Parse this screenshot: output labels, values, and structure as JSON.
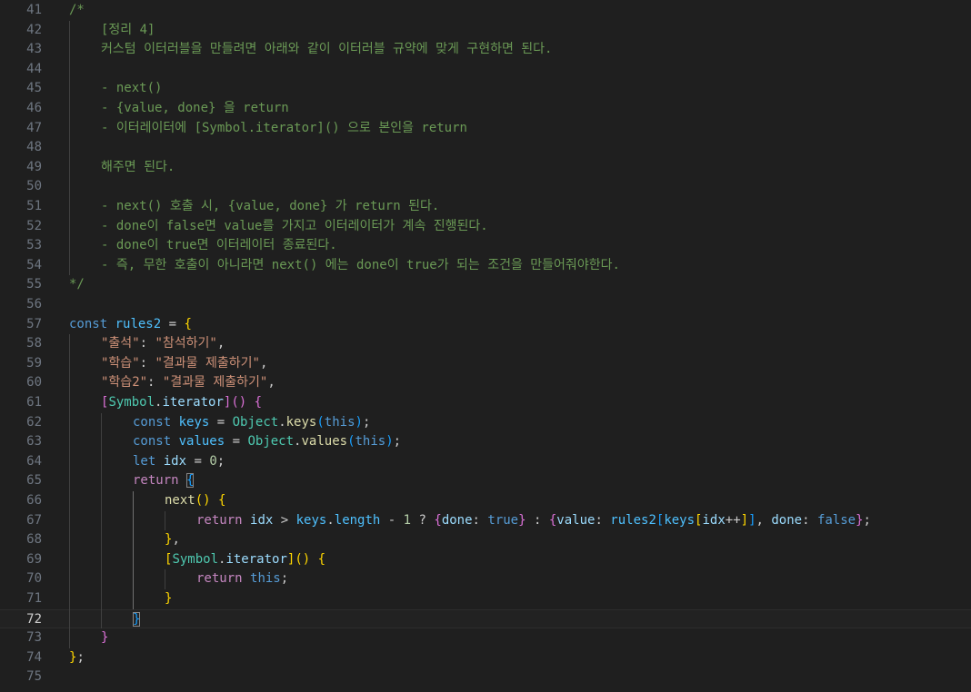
{
  "editor": {
    "language": "javascript",
    "active_line": 72,
    "lines": [
      {
        "n": "41",
        "indent": 0,
        "tokens": [
          {
            "c": "comment",
            "t": "/*"
          }
        ]
      },
      {
        "n": "42",
        "indent": 1,
        "tokens": [
          {
            "c": "comment",
            "t": "[정리 4]"
          }
        ]
      },
      {
        "n": "43",
        "indent": 1,
        "tokens": [
          {
            "c": "comment",
            "t": "커스텀 이터러블을 만들려면 아래와 같이 이터러블 규약에 맞게 구현하면 된다."
          }
        ]
      },
      {
        "n": "44",
        "indent": 0,
        "tokens": []
      },
      {
        "n": "45",
        "indent": 1,
        "tokens": [
          {
            "c": "comment",
            "t": "- next()"
          }
        ]
      },
      {
        "n": "46",
        "indent": 1,
        "tokens": [
          {
            "c": "comment",
            "t": "- {value, done} 을 return"
          }
        ]
      },
      {
        "n": "47",
        "indent": 1,
        "tokens": [
          {
            "c": "comment",
            "t": "- 이터레이터에 [Symbol.iterator]() 으로 본인을 return"
          }
        ]
      },
      {
        "n": "48",
        "indent": 0,
        "tokens": []
      },
      {
        "n": "49",
        "indent": 1,
        "tokens": [
          {
            "c": "comment",
            "t": "해주면 된다."
          }
        ]
      },
      {
        "n": "50",
        "indent": 0,
        "tokens": []
      },
      {
        "n": "51",
        "indent": 1,
        "tokens": [
          {
            "c": "comment",
            "t": "- next() 호출 시, {value, done} 가 return 된다."
          }
        ]
      },
      {
        "n": "52",
        "indent": 1,
        "tokens": [
          {
            "c": "comment",
            "t": "- done이 false면 value를 가지고 이터레이터가 계속 진행된다."
          }
        ]
      },
      {
        "n": "53",
        "indent": 1,
        "tokens": [
          {
            "c": "comment",
            "t": "- done이 true면 이터레이터 종료된다."
          }
        ]
      },
      {
        "n": "54",
        "indent": 1,
        "tokens": [
          {
            "c": "comment",
            "t": "- 즉, 무한 호출이 아니라면 next() 에는 done이 true가 되는 조건을 만들어줘야한다."
          }
        ]
      },
      {
        "n": "55",
        "indent": 0,
        "tokens": [
          {
            "c": "comment",
            "t": "*/"
          }
        ]
      },
      {
        "n": "56",
        "indent": 0,
        "tokens": []
      },
      {
        "n": "57",
        "indent": 0,
        "tokens": [
          {
            "c": "keyword",
            "t": "const"
          },
          {
            "c": "plain",
            "t": " "
          },
          {
            "c": "const",
            "t": "rules2"
          },
          {
            "c": "plain",
            "t": " = "
          },
          {
            "c": "b1",
            "t": "{"
          }
        ]
      },
      {
        "n": "58",
        "indent": 1,
        "tokens": [
          {
            "c": "string",
            "t": "\"출석\""
          },
          {
            "c": "plain",
            "t": ": "
          },
          {
            "c": "string",
            "t": "\"참석하기\""
          },
          {
            "c": "plain",
            "t": ","
          }
        ]
      },
      {
        "n": "59",
        "indent": 1,
        "tokens": [
          {
            "c": "string",
            "t": "\"학습\""
          },
          {
            "c": "plain",
            "t": ": "
          },
          {
            "c": "string",
            "t": "\"결과물 제출하기\""
          },
          {
            "c": "plain",
            "t": ","
          }
        ]
      },
      {
        "n": "60",
        "indent": 1,
        "tokens": [
          {
            "c": "string",
            "t": "\"학습2\""
          },
          {
            "c": "plain",
            "t": ": "
          },
          {
            "c": "string",
            "t": "\"결과물 제출하기\""
          },
          {
            "c": "plain",
            "t": ","
          }
        ]
      },
      {
        "n": "61",
        "indent": 1,
        "tokens": [
          {
            "c": "b2",
            "t": "["
          },
          {
            "c": "class",
            "t": "Symbol"
          },
          {
            "c": "plain",
            "t": "."
          },
          {
            "c": "var",
            "t": "iterator"
          },
          {
            "c": "b2",
            "t": "]"
          },
          {
            "c": "b2",
            "t": "()"
          },
          {
            "c": "plain",
            "t": " "
          },
          {
            "c": "b2",
            "t": "{"
          }
        ]
      },
      {
        "n": "62",
        "indent": 2,
        "tokens": [
          {
            "c": "keyword",
            "t": "const"
          },
          {
            "c": "plain",
            "t": " "
          },
          {
            "c": "const",
            "t": "keys"
          },
          {
            "c": "plain",
            "t": " = "
          },
          {
            "c": "class",
            "t": "Object"
          },
          {
            "c": "plain",
            "t": "."
          },
          {
            "c": "func",
            "t": "keys"
          },
          {
            "c": "b3",
            "t": "("
          },
          {
            "c": "keyword",
            "t": "this"
          },
          {
            "c": "b3",
            "t": ")"
          },
          {
            "c": "plain",
            "t": ";"
          }
        ]
      },
      {
        "n": "63",
        "indent": 2,
        "tokens": [
          {
            "c": "keyword",
            "t": "const"
          },
          {
            "c": "plain",
            "t": " "
          },
          {
            "c": "const",
            "t": "values"
          },
          {
            "c": "plain",
            "t": " = "
          },
          {
            "c": "class",
            "t": "Object"
          },
          {
            "c": "plain",
            "t": "."
          },
          {
            "c": "func",
            "t": "values"
          },
          {
            "c": "b3",
            "t": "("
          },
          {
            "c": "keyword",
            "t": "this"
          },
          {
            "c": "b3",
            "t": ")"
          },
          {
            "c": "plain",
            "t": ";"
          }
        ]
      },
      {
        "n": "64",
        "indent": 2,
        "tokens": [
          {
            "c": "keyword",
            "t": "let"
          },
          {
            "c": "plain",
            "t": " "
          },
          {
            "c": "var",
            "t": "idx"
          },
          {
            "c": "plain",
            "t": " = "
          },
          {
            "c": "number",
            "t": "0"
          },
          {
            "c": "plain",
            "t": ";"
          }
        ]
      },
      {
        "n": "65",
        "indent": 2,
        "tokens": [
          {
            "c": "control",
            "t": "return"
          },
          {
            "c": "plain",
            "t": " "
          },
          {
            "c": "b3m",
            "t": "{"
          }
        ]
      },
      {
        "n": "66",
        "indent": 3,
        "tokens": [
          {
            "c": "func",
            "t": "next"
          },
          {
            "c": "b1",
            "t": "()"
          },
          {
            "c": "plain",
            "t": " "
          },
          {
            "c": "b1",
            "t": "{"
          }
        ]
      },
      {
        "n": "67",
        "indent": 4,
        "tokens": [
          {
            "c": "control",
            "t": "return"
          },
          {
            "c": "plain",
            "t": " "
          },
          {
            "c": "var",
            "t": "idx"
          },
          {
            "c": "plain",
            "t": " > "
          },
          {
            "c": "const",
            "t": "keys"
          },
          {
            "c": "plain",
            "t": "."
          },
          {
            "c": "const",
            "t": "length"
          },
          {
            "c": "plain",
            "t": " - "
          },
          {
            "c": "number",
            "t": "1"
          },
          {
            "c": "plain",
            "t": " ? "
          },
          {
            "c": "b2",
            "t": "{"
          },
          {
            "c": "var",
            "t": "done"
          },
          {
            "c": "plain",
            "t": ": "
          },
          {
            "c": "keyword",
            "t": "true"
          },
          {
            "c": "b2",
            "t": "}"
          },
          {
            "c": "plain",
            "t": " : "
          },
          {
            "c": "b2",
            "t": "{"
          },
          {
            "c": "var",
            "t": "value"
          },
          {
            "c": "plain",
            "t": ": "
          },
          {
            "c": "const",
            "t": "rules2"
          },
          {
            "c": "b3",
            "t": "["
          },
          {
            "c": "const",
            "t": "keys"
          },
          {
            "c": "b1",
            "t": "["
          },
          {
            "c": "var",
            "t": "idx"
          },
          {
            "c": "plain",
            "t": "++"
          },
          {
            "c": "b1",
            "t": "]"
          },
          {
            "c": "b3",
            "t": "]"
          },
          {
            "c": "plain",
            "t": ", "
          },
          {
            "c": "var",
            "t": "done"
          },
          {
            "c": "plain",
            "t": ": "
          },
          {
            "c": "keyword",
            "t": "false"
          },
          {
            "c": "b2",
            "t": "}"
          },
          {
            "c": "plain",
            "t": ";"
          }
        ]
      },
      {
        "n": "68",
        "indent": 3,
        "tokens": [
          {
            "c": "b1",
            "t": "}"
          },
          {
            "c": "plain",
            "t": ","
          }
        ]
      },
      {
        "n": "69",
        "indent": 3,
        "tokens": [
          {
            "c": "b1",
            "t": "["
          },
          {
            "c": "class",
            "t": "Symbol"
          },
          {
            "c": "plain",
            "t": "."
          },
          {
            "c": "var",
            "t": "iterator"
          },
          {
            "c": "b1",
            "t": "]"
          },
          {
            "c": "b1",
            "t": "()"
          },
          {
            "c": "plain",
            "t": " "
          },
          {
            "c": "b1",
            "t": "{"
          }
        ]
      },
      {
        "n": "70",
        "indent": 4,
        "tokens": [
          {
            "c": "control",
            "t": "return"
          },
          {
            "c": "plain",
            "t": " "
          },
          {
            "c": "keyword",
            "t": "this"
          },
          {
            "c": "plain",
            "t": ";"
          }
        ]
      },
      {
        "n": "71",
        "indent": 3,
        "tokens": [
          {
            "c": "b1",
            "t": "}"
          }
        ]
      },
      {
        "n": "72",
        "indent": 2,
        "tokens": [
          {
            "c": "b3m",
            "t": "}"
          }
        ]
      },
      {
        "n": "73",
        "indent": 1,
        "tokens": [
          {
            "c": "b2",
            "t": "}"
          }
        ]
      },
      {
        "n": "74",
        "indent": 0,
        "tokens": [
          {
            "c": "b1",
            "t": "}"
          },
          {
            "c": "plain",
            "t": ";"
          }
        ]
      },
      {
        "n": "75",
        "indent": 0,
        "tokens": []
      }
    ]
  }
}
